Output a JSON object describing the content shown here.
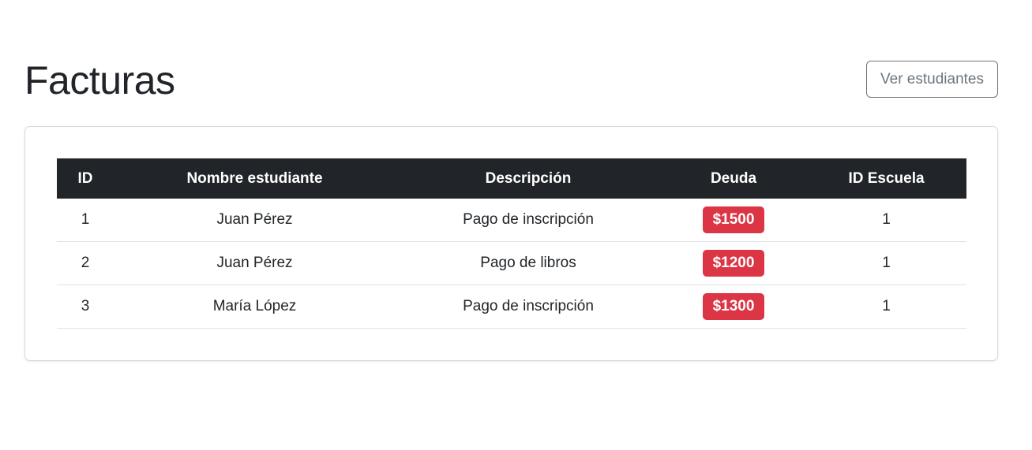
{
  "header": {
    "title": "Facturas",
    "view_students_label": "Ver estudiantes"
  },
  "table": {
    "columns": [
      "ID",
      "Nombre estudiante",
      "Descripción",
      "Deuda",
      "ID Escuela"
    ],
    "rows": [
      {
        "id": "1",
        "student": "Juan Pérez",
        "description": "Pago de inscripción",
        "debt": "$1500",
        "school_id": "1"
      },
      {
        "id": "2",
        "student": "Juan Pérez",
        "description": "Pago de libros",
        "debt": "$1200",
        "school_id": "1"
      },
      {
        "id": "3",
        "student": "María López",
        "description": "Pago de inscripción",
        "debt": "$1300",
        "school_id": "1"
      }
    ]
  },
  "colors": {
    "table_header_bg": "#212529",
    "debt_badge": "#dc3545",
    "outline_button": "#6c757d"
  }
}
